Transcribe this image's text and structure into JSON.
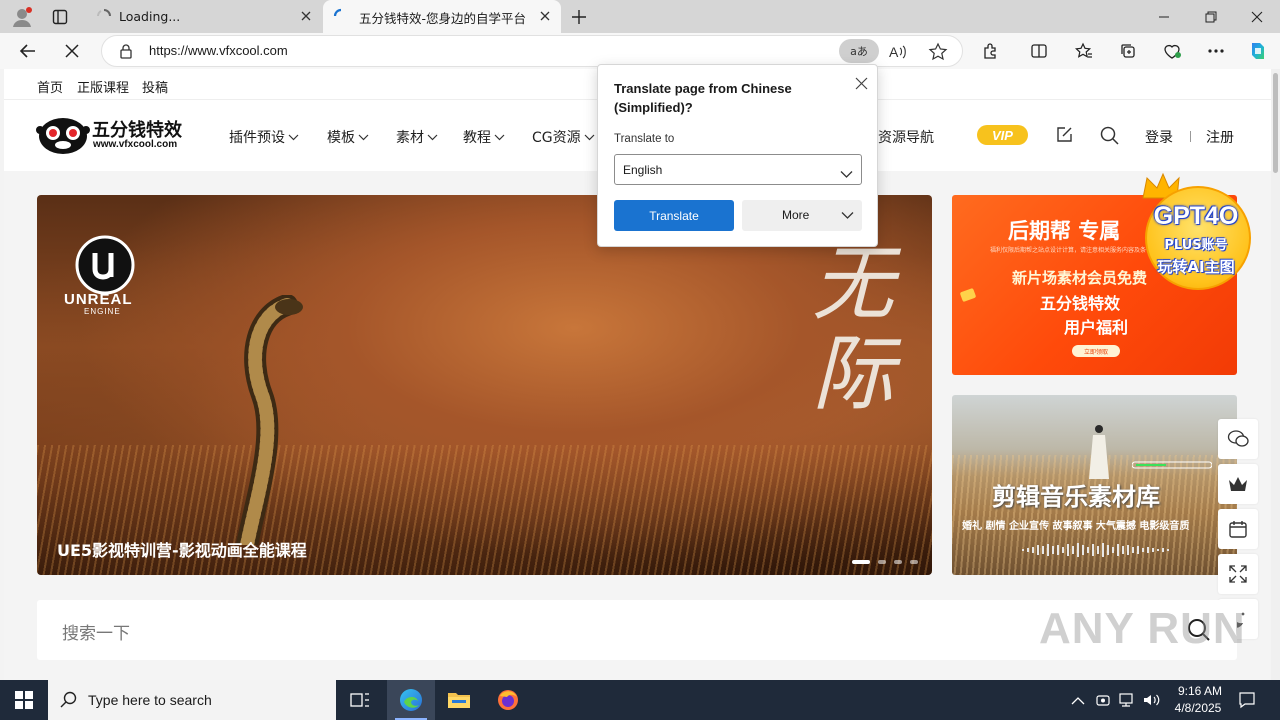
{
  "browser": {
    "tabs": [
      {
        "title": "Loading...",
        "state": "loading"
      },
      {
        "title": "五分钱特效-您身边的自学平台",
        "state": "active"
      }
    ],
    "new_tab_label": "+",
    "url": "https://www.vfxcool.com",
    "translate_pill_label": "aあ",
    "window_controls": [
      "minimize-icon",
      "restore-icon",
      "close-icon"
    ]
  },
  "site": {
    "topbar": {
      "items": [
        "首页",
        "正版课程",
        "投稿"
      ]
    },
    "logo": {
      "name": "五分钱特效",
      "url_text": "www.vfxcool.com"
    },
    "nav": {
      "items": [
        "插件预设",
        "模板",
        "素材",
        "教程",
        "CG资源",
        "资源导航"
      ]
    },
    "vip_label": "VIP",
    "login_label": "登录",
    "register_label": "注册",
    "hero": {
      "engine_name": "UNREAL",
      "engine_sub": "ENGINE",
      "calligraphy": "无际",
      "caption": "UE5影视特训营-影视动画全能课程",
      "slide_count": 4,
      "active_slide": 1
    },
    "banner1": {
      "title": "后期帮 专属",
      "subtitle": "福利仅限后期帮之站点设计计算，请注意相关服务内容及条件条款",
      "line2": "新片场素材会员免费",
      "line3": "五分钱特效",
      "line4": "用户福利",
      "button": "立即领取"
    },
    "gpt_badge": {
      "line1": "GPT4O",
      "line2": "PLUS账号",
      "line3": "玩转AI主图"
    },
    "banner2": {
      "title": "剪辑音乐素材库",
      "tags": "婚礼 剧情 企业宣传 故事叙事 大气震撼 电影级音质"
    },
    "float_buttons": [
      "wechat-icon",
      "crown-icon",
      "calendar-icon",
      "fullscreen-icon",
      "moon-icon"
    ],
    "search": {
      "placeholder": "搜索一下"
    },
    "watermark": "ANY RUN"
  },
  "translate_popup": {
    "title": "Translate page from Chinese (Simplified)?",
    "translate_to_label": "Translate to",
    "language": "English",
    "translate_button": "Translate",
    "more_button": "More"
  },
  "taskbar": {
    "search_placeholder": "Type here to search",
    "apps": [
      "task-view-icon",
      "edge-icon",
      "file-explorer-icon",
      "firefox-icon"
    ],
    "active_app": "edge-icon",
    "time": "9:16 AM",
    "date": "4/8/2025"
  },
  "colors": {
    "accent_blue": "#1a73d0",
    "vip_yellow": "#f7c21d",
    "banner_orange": "#ff4a0a",
    "taskbar": "#1f2a3a"
  }
}
